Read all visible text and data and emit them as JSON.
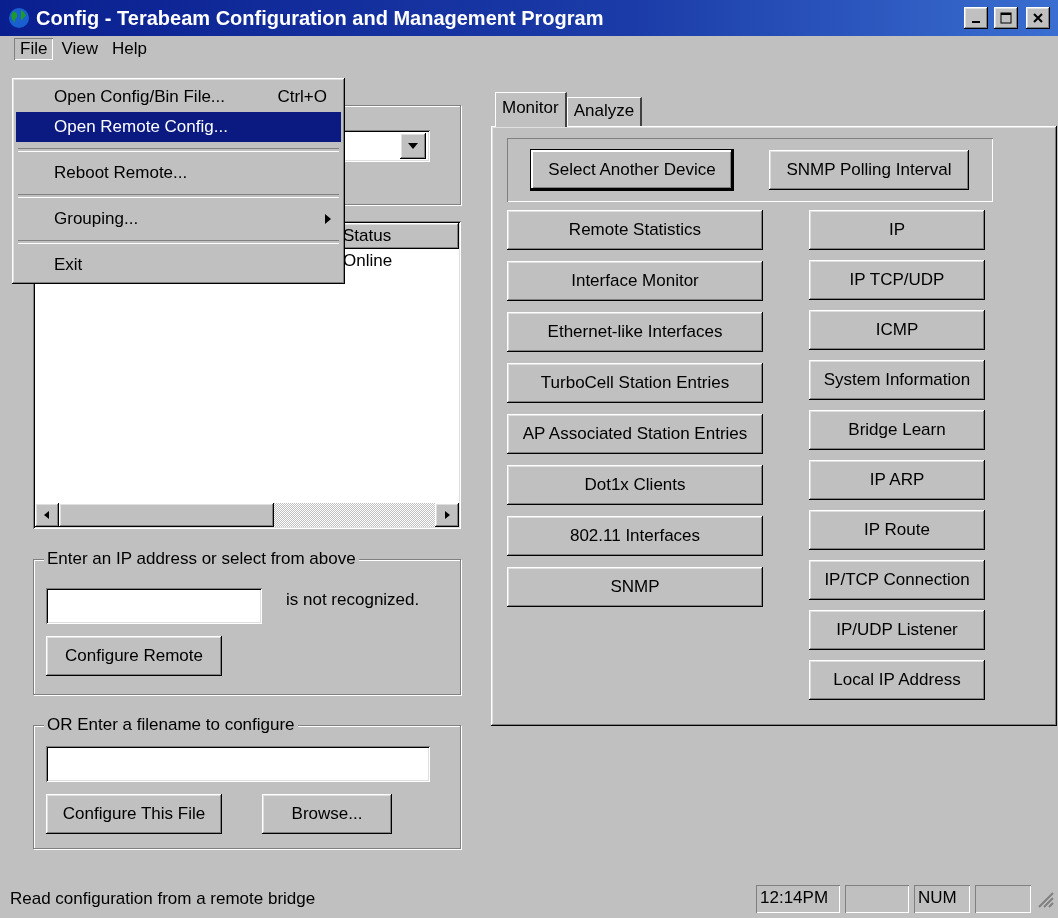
{
  "window": {
    "title": "Config - Terabeam Configuration and Management Program"
  },
  "menu_bar": [
    {
      "label": "File",
      "selected": true
    },
    {
      "label": "View",
      "selected": false
    },
    {
      "label": "Help",
      "selected": false
    }
  ],
  "open_menu": {
    "groups": [
      [
        {
          "label": "Open Config/Bin File...",
          "shortcut": "Ctrl+O",
          "selected": false,
          "submenu": false
        },
        {
          "label": "Open Remote Config...",
          "selected": true,
          "submenu": false
        }
      ],
      [
        {
          "label": "Reboot Remote...",
          "selected": false,
          "submenu": false
        }
      ],
      [
        {
          "label": "Grouping...",
          "selected": false,
          "submenu": true
        }
      ],
      [
        {
          "label": "Exit",
          "selected": false,
          "submenu": false
        }
      ]
    ]
  },
  "device_list": {
    "columns": [
      "Status"
    ],
    "rows": [
      [
        "Online"
      ]
    ]
  },
  "ip_group": {
    "label": "Enter an IP address or select from above",
    "note": "is not recognized.",
    "button": "Configure Remote"
  },
  "file_group": {
    "label": "OR Enter a filename to configure",
    "buttons": [
      "Configure This File",
      "Browse..."
    ]
  },
  "tabs": [
    {
      "label": "Monitor",
      "selected": true
    },
    {
      "label": "Analyze",
      "selected": false
    }
  ],
  "top_buttons": [
    {
      "label": "Select Another Device",
      "default": true
    },
    {
      "label": "SNMP Polling Interval",
      "default": false
    }
  ],
  "left_buttons": [
    "Remote Statistics",
    "Interface Monitor",
    "Ethernet-like Interfaces",
    "TurboCell Station Entries",
    "AP Associated Station Entries",
    "Dot1x Clients",
    "802.11 Interfaces",
    "SNMP"
  ],
  "right_buttons": [
    "IP",
    "IP TCP/UDP",
    "ICMP",
    "System Information",
    "Bridge Learn",
    "IP ARP",
    "IP Route",
    "IP/TCP Connection",
    "IP/UDP Listener",
    "Local IP Address"
  ],
  "status_bar": {
    "message": "Read configuration from a remote bridge",
    "panes": [
      {
        "kind": "text",
        "text": "12:14PM"
      },
      {
        "kind": "blank"
      },
      {
        "kind": "text",
        "text": "NUM"
      },
      {
        "kind": "blank"
      }
    ]
  }
}
